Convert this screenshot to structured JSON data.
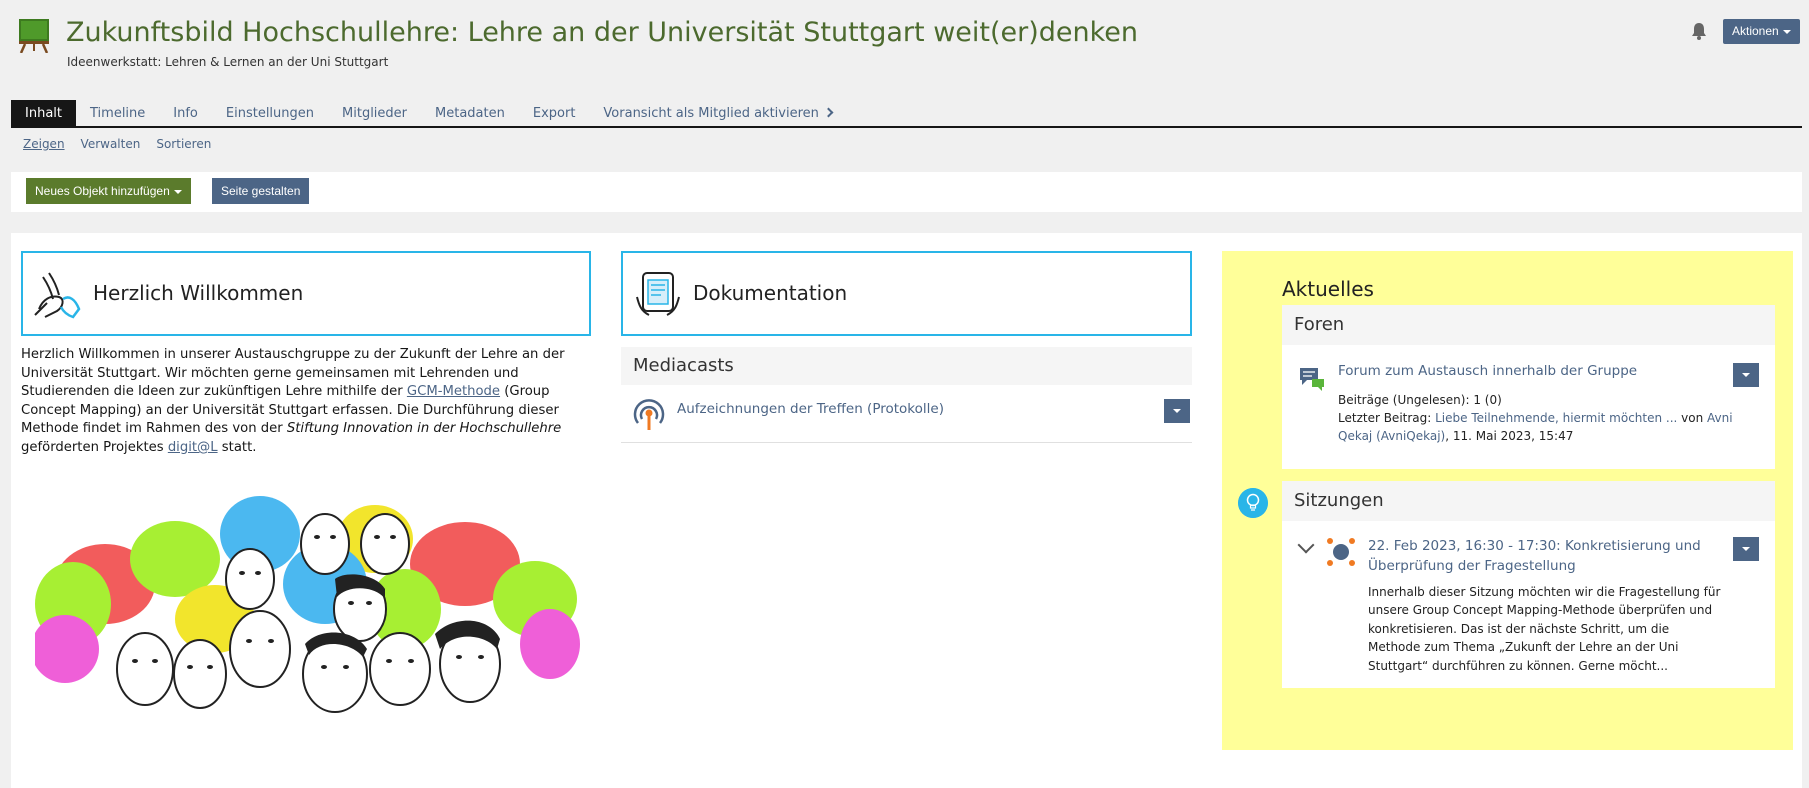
{
  "header": {
    "title": "Zukunftsbild Hochschullehre: Lehre an der Universität Stuttgart weit(er)denken",
    "subtitle": "Ideenwerkstatt: Lehren & Lernen an der Uni Stuttgart",
    "actions_label": "Aktionen"
  },
  "tabs": [
    {
      "label": "Inhalt",
      "active": true
    },
    {
      "label": "Timeline"
    },
    {
      "label": "Info"
    },
    {
      "label": "Einstellungen"
    },
    {
      "label": "Mitglieder"
    },
    {
      "label": "Metadaten"
    },
    {
      "label": "Export"
    },
    {
      "label": "Voransicht als Mitglied aktivieren"
    }
  ],
  "subtabs": [
    {
      "label": "Zeigen",
      "active": true
    },
    {
      "label": "Verwalten"
    },
    {
      "label": "Sortieren"
    }
  ],
  "toolbar": {
    "add_label": "Neues Objekt hinzufügen",
    "design_label": "Seite gestalten"
  },
  "welcome": {
    "title": "Herzlich Willkommen",
    "text_1": "Herzlich Willkommen in unserer Austauschgruppe zu der Zukunft der Lehre an der Uni­versität Stuttgart. Wir möchten gerne gemeinsamen mit Lehrenden und Studierenden die Ideen zur zukünftigen Lehre mithilfe der ",
    "link_gcm": "GCM-Methode",
    "text_2": " (Group Concept Mapping) an der Universität Stuttgart erfassen. Die Durchführung dieser Methode findet im Rah­men des von der ",
    "text_em": "Stiftung Innovation in der Hochschullehre",
    "text_3": " geförderten Projektes ",
    "link_digit": "digit@L",
    "text_4": " statt."
  },
  "documentation": {
    "title": "Dokumentation",
    "mediacasts_heading": "Mediacasts",
    "mediacast_item": "Aufzeichnungen der Treffen (Protokolle)"
  },
  "aktuelles": {
    "title": "Aktuelles",
    "forums": {
      "heading": "Foren",
      "forum_title": "Forum zum Austausch innerhalb der Gruppe",
      "posts_label": "Beiträge (Ungelesen): ",
      "posts_value": "1 (0)",
      "last_label": "Letzter Beitrag: ",
      "last_link": "Liebe Teilnehmende, hiermit möchten ...",
      "last_by": " von ",
      "last_author": "Avni Qekaj (AvniQekaj)",
      "last_date": ", 11. Mai 2023, 15:47"
    },
    "sessions": {
      "heading": "Sitzungen",
      "session_title": "22. Feb 2023, 16:30 - 17:30: Konkretisierung und Überprüfung der Fragestellung",
      "session_desc": "Innerhalb dieser Sitzung möchten wir die Fragestellung für unsere Group Concept Mapping-Methode überprüfen und konkretisieren. Das ist der nächste Schritt, um die Methode zum Thema „Zukunft der Lehre an der Uni Stuttgart“ durch­führen zu können. Gerne möcht..."
    }
  },
  "colors": {
    "accent_blue": "#4c6586",
    "accent_green": "#5b7b2c",
    "title_green": "#4c6a2e",
    "highlight_yellow": "#ffff99",
    "box_border": "#29b5e8"
  }
}
